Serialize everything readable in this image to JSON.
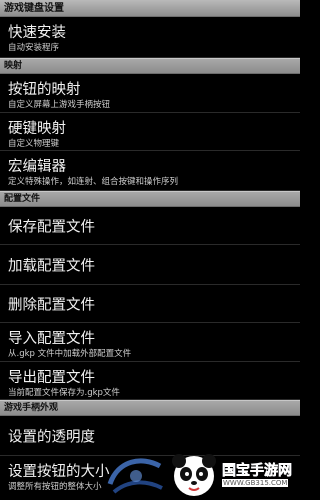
{
  "app": {
    "title": "游戏键盘设置"
  },
  "sections": {
    "mapping": "映射",
    "config": "配置文件",
    "appearance": "游戏手柄外观"
  },
  "items": {
    "quick_install": {
      "title": "快速安装",
      "sub": "自动安装程序"
    },
    "button_mapping": {
      "title": "按钮的映射",
      "sub": "自定义屏幕上游戏手柄按钮"
    },
    "hardkey_mapping": {
      "title": "硬键映射",
      "sub": "自定义物理键"
    },
    "macro_editor": {
      "title": "宏编辑器",
      "sub": "定义特殊操作，如连射、组合按键和操作序列"
    },
    "save_config": {
      "title": "保存配置文件"
    },
    "load_config": {
      "title": "加载配置文件"
    },
    "delete_config": {
      "title": "删除配置文件"
    },
    "import_config": {
      "title": "导入配置文件",
      "sub": "从.gkp 文件中加载外部配置文件"
    },
    "export_config": {
      "title": "导出配置文件",
      "sub": "当前配置文件保存为.gkp文件"
    },
    "transparency": {
      "title": "设置的透明度"
    },
    "button_size": {
      "title": "设置按钮的大小",
      "sub": "调整所有按钮的整体大小"
    }
  },
  "watermark": {
    "brand": "国宝手游网",
    "url": "WWW.GB315.COM"
  },
  "colors": {
    "background": "#000000",
    "header_bg": "#9a9a9a",
    "text": "#f2f2f2",
    "subtext": "#cfcfcf",
    "brand_blue": "#3a74d8"
  }
}
